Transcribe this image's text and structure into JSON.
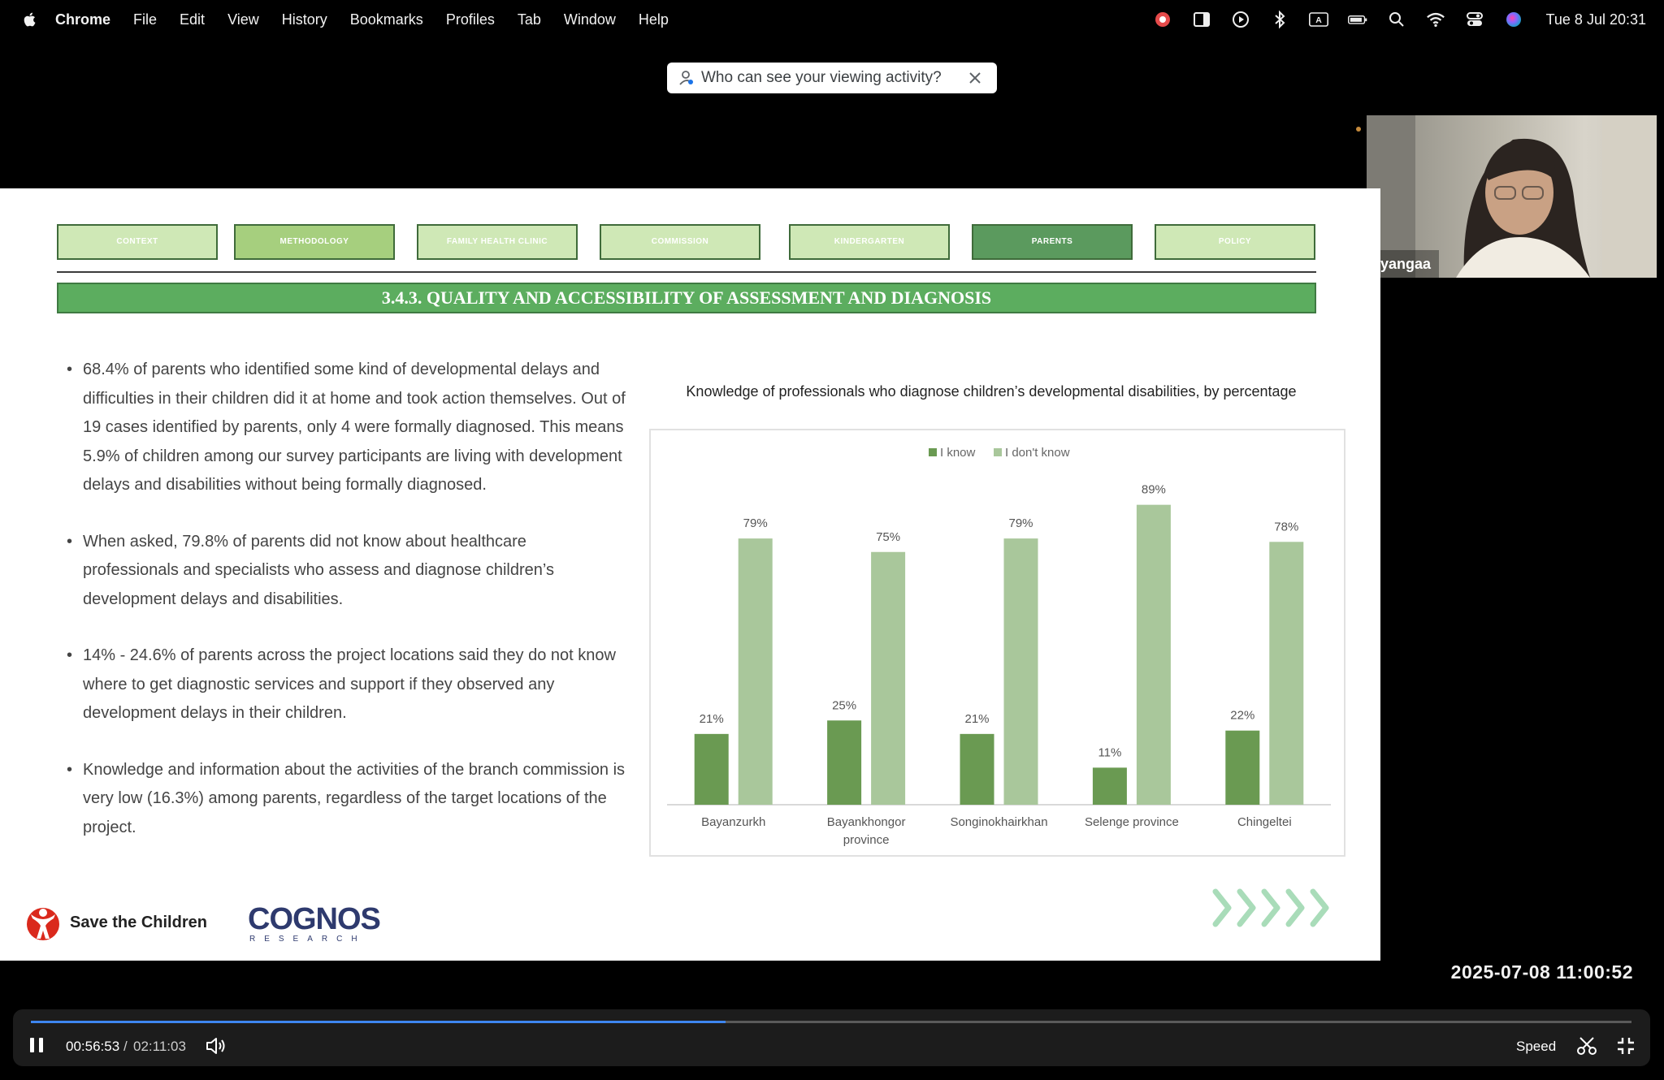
{
  "menubar": {
    "app_name": "Chrome",
    "items": [
      "File",
      "Edit",
      "View",
      "History",
      "Bookmarks",
      "Profiles",
      "Tab",
      "Window",
      "Help"
    ],
    "input_indicator": "A",
    "clock": "Tue 8 Jul  20:31",
    "status_icons": [
      "screen-record-icon",
      "sidebar-icon",
      "play-circle-icon",
      "bluetooth-icon",
      "input-source-icon",
      "battery-icon",
      "spotlight-search-icon",
      "wifi-icon",
      "control-center-icon",
      "siri-icon"
    ]
  },
  "privacy_banner": {
    "text": "Who can see your viewing activity?",
    "icons": [
      "person-icon",
      "close-icon"
    ]
  },
  "webcam": {
    "participant_name": "Uyangaa"
  },
  "slide": {
    "tabs": [
      {
        "label": "CONTEXT",
        "state": "normal"
      },
      {
        "label": "METHODOLOGY",
        "state": "method"
      },
      {
        "label": "FAMILY HEALTH CLINIC",
        "state": "normal"
      },
      {
        "label": "COMMISSION",
        "state": "normal"
      },
      {
        "label": "KINDERGARTEN",
        "state": "normal"
      },
      {
        "label": "PARENTS",
        "state": "active"
      },
      {
        "label": "POLICY",
        "state": "normal"
      }
    ],
    "section_title": "3.4.3. QUALITY AND ACCESSIBILITY OF ASSESSMENT AND DIAGNOSIS",
    "bullets": [
      "68.4% of parents who identified some kind of developmental delays and difficulties in their children did it at home and took action themselves. Out of 19 cases identified by parents, only 4 were formally diagnosed. This means 5.9% of children among our survey participants are living with development delays and disabilities without being formally diagnosed.",
      "When asked, 79.8% of parents did not know about healthcare professionals and specialists who assess and diagnose children’s development delays and disabilities.",
      "14% - 24.6% of parents across the project locations said they do not know where to get diagnostic services and support if they observed any development delays in their children.",
      "Knowledge and information about the activities of the branch commission is very low (16.3%) among parents, regardless of the target locations of the project."
    ],
    "logos": {
      "save_the_children": "Save the Children",
      "cognos": "COGNOS",
      "cognos_sub": "RESEARCH"
    },
    "colors": {
      "tab_fill": "#cfe8b6",
      "tab_active": "#5b9a5e",
      "title_bar": "#5cad5f",
      "chevrons": "#a9dcb9"
    }
  },
  "chart_data": {
    "type": "bar",
    "title": "Knowledge of professionals who diagnose children’s developmental disabilities, by percentage",
    "categories": [
      "Bayanzurkh",
      "Bayankhongor province",
      "Songinokhairkhan",
      "Selenge province",
      "Chingeltei"
    ],
    "category_lines": [
      [
        "Bayanzurkh"
      ],
      [
        "Bayankhongor",
        "province"
      ],
      [
        "Songinokhairkhan"
      ],
      [
        "Selenge province"
      ],
      [
        "Chingeltei"
      ]
    ],
    "series": [
      {
        "name": "I know",
        "values": [
          21,
          25,
          21,
          11,
          22
        ],
        "labels": [
          "21%",
          "25%",
          "21%",
          "11%",
          "22%"
        ],
        "color": "#6a9a52"
      },
      {
        "name": "I don't know",
        "values": [
          79,
          75,
          79,
          89,
          78
        ],
        "labels": [
          "79%",
          "75%",
          "79%",
          "89%",
          "78%"
        ],
        "color": "#a9c79b"
      }
    ],
    "ylim": [
      0,
      100
    ],
    "grid": false,
    "legend": "top-center"
  },
  "player": {
    "timestamp": "2025-07-08  11:00:52",
    "current_time": "00:56:53",
    "separator": "/",
    "total_time": "02:11:03",
    "progress": 0.434,
    "speed_label": "Speed",
    "icons": [
      "pause-icon",
      "volume-icon",
      "clip-icon",
      "exit-fullscreen-icon"
    ]
  }
}
